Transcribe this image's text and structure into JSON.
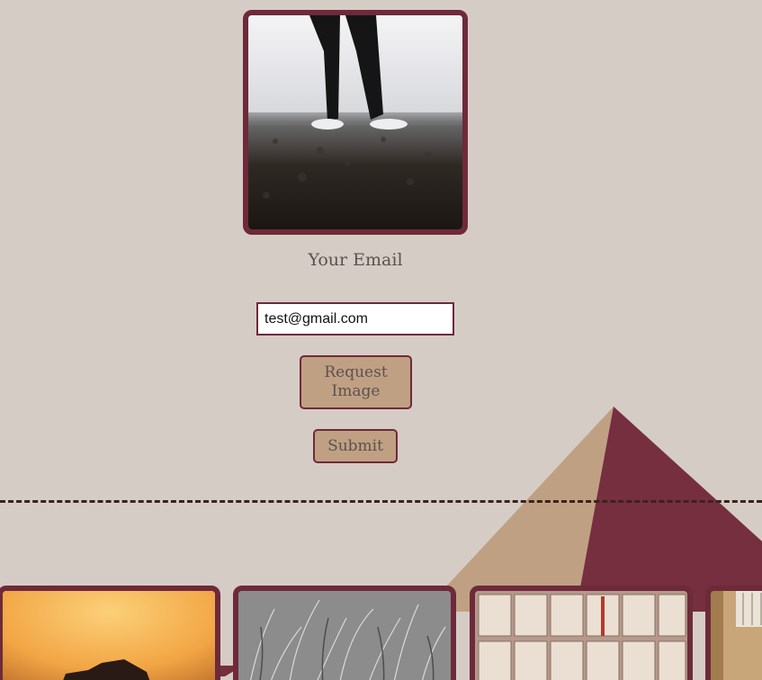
{
  "form": {
    "email_label": "Your Email",
    "email_value": "test@gmail.com",
    "request_button_label": "Request Image",
    "submit_button_label": "Submit"
  },
  "images": {
    "hero": "person-standing-in-sneakers-photo",
    "thumbnails": [
      "sunset-silhouette-photo",
      "grayscale-grass-photo",
      "open-books-wall-photo",
      "building-interior-photo"
    ]
  },
  "colors": {
    "background": "#d6ccc6",
    "accent_maroon": "#6e2a3a",
    "accent_tan": "#c0a083",
    "divider": "#3b2418"
  }
}
